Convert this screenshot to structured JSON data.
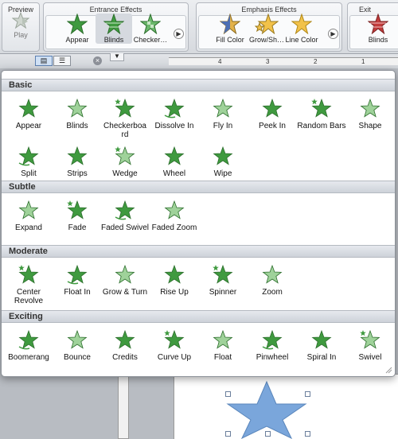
{
  "ribbon": {
    "preview": {
      "title": "Preview",
      "play_label": "Play"
    },
    "entrance": {
      "title": "Entrance Effects",
      "items": [
        {
          "label": "Appear",
          "icon": "star-appear-icon"
        },
        {
          "label": "Blinds",
          "icon": "star-blinds-icon"
        },
        {
          "label": "Checker…",
          "icon": "star-checker-icon"
        }
      ]
    },
    "emphasis": {
      "title": "Emphasis Effects",
      "items": [
        {
          "label": "Fill Color",
          "icon": "star-fill-color-icon"
        },
        {
          "label": "Grow/Sh…",
          "icon": "star-grow-shrink-icon"
        },
        {
          "label": "Line Color",
          "icon": "star-line-color-icon"
        }
      ]
    },
    "exit": {
      "title": "Exit",
      "items": [
        {
          "label": "Blinds",
          "icon": "star-exit-blinds-icon"
        }
      ]
    }
  },
  "ruler": {
    "marks": [
      "4",
      "3",
      "2",
      "1"
    ]
  },
  "popup": {
    "sections": [
      {
        "title": "Basic",
        "items": [
          "Appear",
          "Blinds",
          "Checkerboa rd",
          "Dissolve In",
          "Fly In",
          "Peek In",
          "Random Bars",
          "Shape",
          "Split",
          "Strips",
          "Wedge",
          "Wheel",
          "Wipe"
        ]
      },
      {
        "title": "Subtle",
        "items": [
          "Expand",
          "Fade",
          "Faded Swivel",
          "Faded Zoom"
        ]
      },
      {
        "title": "Moderate",
        "items": [
          "Center Revolve",
          "Float In",
          "Grow & Turn",
          "Rise Up",
          "Spinner",
          "Zoom"
        ]
      },
      {
        "title": "Exciting",
        "items": [
          "Boomerang",
          "Bounce",
          "Credits",
          "Curve Up",
          "Float",
          "Pinwheel",
          "Spiral In",
          "Swivel"
        ]
      }
    ]
  },
  "colors": {
    "star_green": "#3f9a3f",
    "star_light": "#9fd29a",
    "slide_star": "#7aa6db"
  }
}
